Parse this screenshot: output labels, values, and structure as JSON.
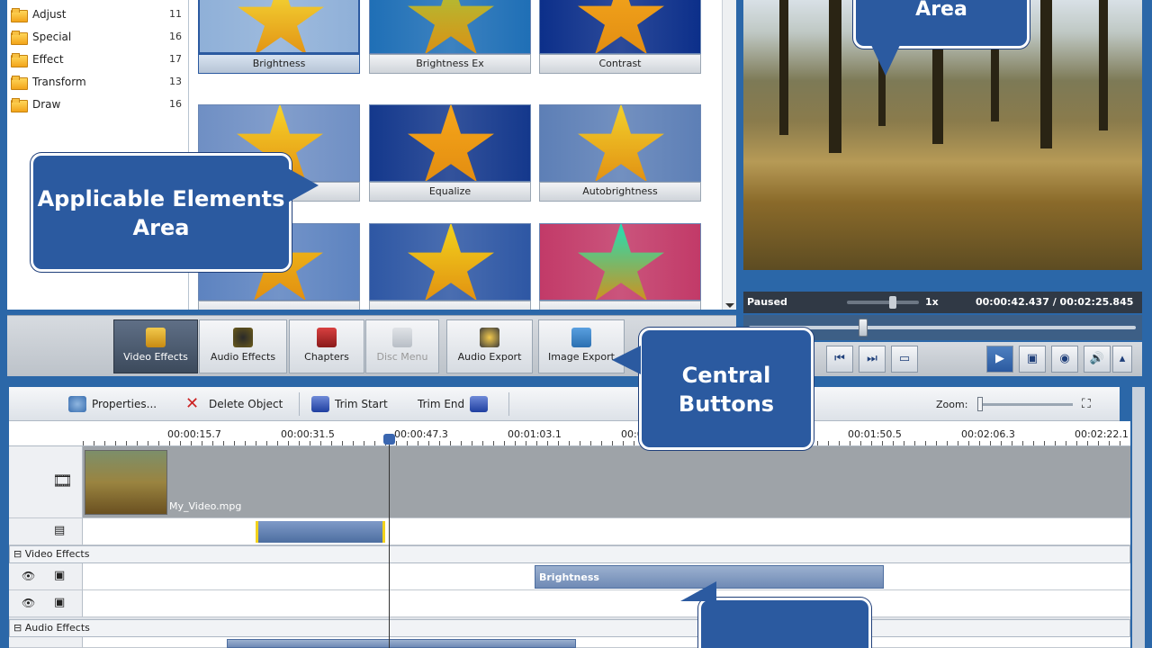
{
  "categories": [
    {
      "label": "Adjust",
      "count": "11"
    },
    {
      "label": "Special",
      "count": "16"
    },
    {
      "label": "Effect",
      "count": "17"
    },
    {
      "label": "Transform",
      "count": "13"
    },
    {
      "label": "Draw",
      "count": "16"
    }
  ],
  "effects": [
    {
      "label": "Brightness",
      "bg": "#8fb0d8",
      "star": "#f7e23a",
      "selected": true
    },
    {
      "label": "Brightness Ex",
      "bg": "#1f6fb6",
      "star": "#a6c83c"
    },
    {
      "label": "Contrast",
      "bg": "#0c2f8a",
      "star": "#f5a81e"
    },
    {
      "label": "",
      "bg": "#6f8fc4",
      "star": "#f7d52a"
    },
    {
      "label": "Equalize",
      "bg": "#14388c",
      "star": "#f7a71a"
    },
    {
      "label": "Autobrightness",
      "bg": "#5d7fb6",
      "star": "#f2d22c"
    },
    {
      "label": "",
      "bg": "#5d83c0",
      "star": "#f2c21a"
    },
    {
      "label": "",
      "bg": "#2e57a4",
      "star": "#f2d41c"
    },
    {
      "label": "",
      "bg": "#c23a68",
      "star": "#1fe0b8"
    }
  ],
  "player": {
    "status": "Paused",
    "speed": "1x",
    "time": "00:00:42.437 / 00:02:25.845"
  },
  "central_buttons": [
    {
      "label": "Video Effects",
      "active": true
    },
    {
      "label": "Audio Effects"
    },
    {
      "label": "Chapters"
    },
    {
      "label": "Disc Menu",
      "disabled": true
    },
    {
      "label": "Audio Export"
    },
    {
      "label": "Image Export"
    }
  ],
  "toolbar": {
    "properties": "Properties...",
    "delete": "Delete Object",
    "trim_start": "Trim Start",
    "trim_end": "Trim End",
    "zoom": "Zoom:"
  },
  "ruler": [
    "00:00:15.7",
    "00:00:31.5",
    "00:00:47.3",
    "00:01:03.1",
    "00:0",
    "00:01:50.5",
    "00:02:06.3",
    "00:02:22.1"
  ],
  "tracks": {
    "video_clip": "My_Video.mpg",
    "video_effects": "Video Effects",
    "audio_effects": "Audio Effects",
    "effect_clip": "Brightness"
  },
  "callouts": {
    "applicable": "Applicable Elements Area",
    "central": "Central Buttons",
    "area": "Area"
  }
}
